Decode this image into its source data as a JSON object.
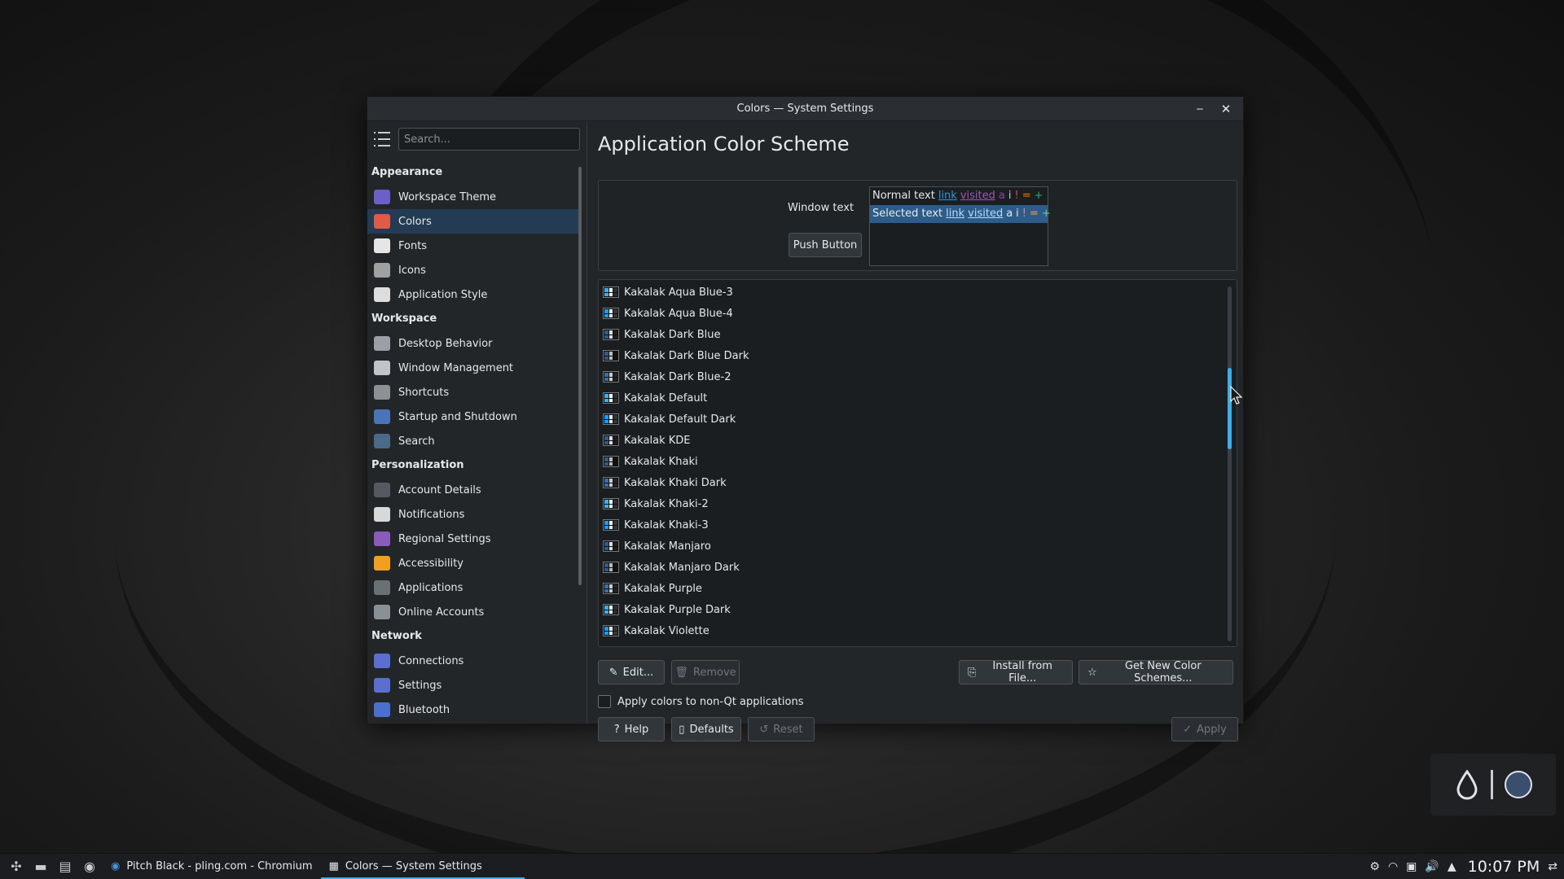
{
  "window": {
    "title": "Colors — System Settings"
  },
  "sidebar": {
    "search_placeholder": "Search...",
    "categories": [
      {
        "label": "Appearance",
        "items": [
          {
            "label": "Workspace Theme",
            "icon": "workspace-theme-icon",
            "color": "#6c5fc7"
          },
          {
            "label": "Colors",
            "icon": "colors-icon",
            "color": "#e05a48",
            "active": true
          },
          {
            "label": "Fonts",
            "icon": "fonts-icon",
            "color": "#e6e6e6"
          },
          {
            "label": "Icons",
            "icon": "icons-icon",
            "color": "#a0a0a0"
          },
          {
            "label": "Application Style",
            "icon": "application-style-icon",
            "color": "#dddddd"
          }
        ]
      },
      {
        "label": "Workspace",
        "items": [
          {
            "label": "Desktop Behavior",
            "icon": "desktop-behavior-icon",
            "color": "#9aa0a6"
          },
          {
            "label": "Window Management",
            "icon": "window-management-icon",
            "color": "#bfc5cb"
          },
          {
            "label": "Shortcuts",
            "icon": "shortcuts-icon",
            "color": "#8c9196"
          },
          {
            "label": "Startup and Shutdown",
            "icon": "startup-shutdown-icon",
            "color": "#4a74b8"
          },
          {
            "label": "Search",
            "icon": "search-icon",
            "color": "#4a6a8a"
          }
        ]
      },
      {
        "label": "Personalization",
        "items": [
          {
            "label": "Account Details",
            "icon": "account-details-icon",
            "color": "#555a60"
          },
          {
            "label": "Notifications",
            "icon": "notifications-icon",
            "color": "#d8d8d8"
          },
          {
            "label": "Regional Settings",
            "icon": "regional-settings-icon",
            "color": "#8a5bb8"
          },
          {
            "label": "Accessibility",
            "icon": "accessibility-icon",
            "color": "#f0a020"
          },
          {
            "label": "Applications",
            "icon": "applications-icon",
            "color": "#6a7076"
          },
          {
            "label": "Online Accounts",
            "icon": "online-accounts-icon",
            "color": "#8a9096"
          }
        ]
      },
      {
        "label": "Network",
        "items": [
          {
            "label": "Connections",
            "icon": "connections-icon",
            "color": "#5a6fd0"
          },
          {
            "label": "Settings",
            "icon": "network-settings-icon",
            "color": "#5a6fd0"
          },
          {
            "label": "Bluetooth",
            "icon": "bluetooth-icon",
            "color": "#4a6fd0"
          }
        ]
      }
    ]
  },
  "main": {
    "title": "Application Color Scheme",
    "preview": {
      "window_text": "Window text",
      "push_button": "Push Button",
      "normal_text": "Normal text",
      "selected_text": "Selected text",
      "link": "link",
      "visited": "visited",
      "chars": [
        "a",
        "i",
        "!",
        "=",
        "+"
      ]
    },
    "schemes": [
      "Kakalak Aqua Blue-3",
      "Kakalak Aqua Blue-4",
      "Kakalak Dark Blue",
      "Kakalak Dark Blue Dark",
      "Kakalak Dark Blue-2",
      "Kakalak Default",
      "Kakalak Default Dark",
      "Kakalak KDE",
      "Kakalak Khaki",
      "Kakalak Khaki Dark",
      "Kakalak Khaki-2",
      "Kakalak Khaki-3",
      "Kakalak Manjaro",
      "Kakalak Manjaro Dark",
      "Kakalak Purple",
      "Kakalak Purple Dark",
      "Kakalak Violette"
    ],
    "buttons": {
      "edit": "Edit...",
      "remove": "Remove",
      "install": "Install from File...",
      "get_new": "Get New Color Schemes...",
      "help": "Help",
      "defaults": "Defaults",
      "reset": "Reset",
      "apply": "Apply"
    },
    "checkbox_label": "Apply colors to non-Qt applications"
  },
  "taskbar": {
    "tasks": [
      {
        "label": "Pitch Black - pling.com - Chromium",
        "icon": "chromium-icon"
      },
      {
        "label": "Colors — System Settings",
        "icon": "system-settings-icon",
        "active": true
      }
    ],
    "clock": "10:07 PM"
  },
  "colors": {
    "accent": "#3daee9",
    "selection": "#233c54",
    "window_bg": "#232629"
  }
}
